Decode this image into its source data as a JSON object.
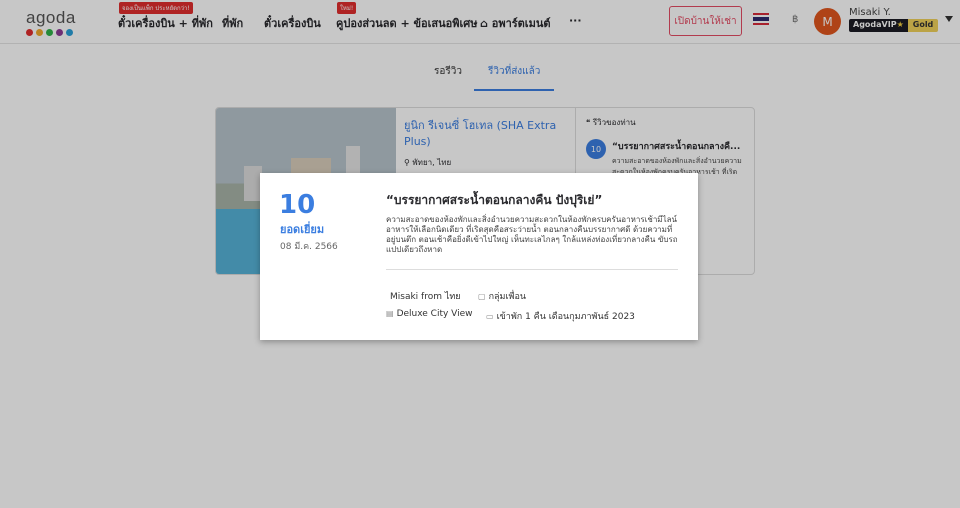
{
  "header": {
    "logo": "agoda",
    "logo_dots": [
      "#e12d2d",
      "#f0a92b",
      "#30b14a",
      "#8e3c97",
      "#2a9fd8"
    ],
    "nav": [
      {
        "label": "ตั๋วเครื่องบิน + ที่พัก",
        "badge": "จองเป็นแพ็ก ประหยัดกว่า!"
      },
      {
        "label": "ที่พัก"
      },
      {
        "label": "ตั๋วเครื่องบิน"
      },
      {
        "label": "คูปองส่วนลด + ข้อเสนอพิเศษ",
        "badge": "ใหม่!"
      },
      {
        "label": "อพาร์ตเมนต์",
        "icon": "home-icon"
      },
      {
        "label": "···"
      }
    ],
    "host_button": "เปิดบ้านให้เช่า",
    "currency": "฿",
    "avatar_initial": "M",
    "user_name": "Misaki Y.",
    "vip_label": "AgodaVIP",
    "vip_tier": "Gold"
  },
  "tabs": [
    {
      "label": "รอรีวิว",
      "active": false
    },
    {
      "label": "รีวิวที่ส่งแล้ว",
      "active": true
    }
  ],
  "card": {
    "hotel_name": "ยูนิก รีเจนซี่ โฮเทล (SHA Extra Plus)",
    "location": "พัทยา, ไทย",
    "review_heading": "รีวิวของท่าน",
    "score": "10",
    "review_title": "“บรรยากาศสระน้ำตอนกลางคื...",
    "review_snippet": "ความสะอาดของห้องพักและสิ่งอำนวยความสะดวกในห้องพักครบครันอาหารเช้า ที่เริดสุดคือบรรยากาศดี ด..."
  },
  "modal": {
    "score": "10",
    "score_label": "ยอดเยี่ยม",
    "date": "08 มี.ค. 2566",
    "title": "“บรรยากาศสระน้ำตอนกลางคืน ปังปุริเย่”",
    "body": "ความสะอาดของห้องพักและสิ่งอำนวยความสะดวกในห้องพักครบครันอาหารเช้ามีไลน์อาหารให้เลือกนิดเดียว ที่เริดสุดคือสระว่ายน้ำ ตอนกลางคืนบรรยากาศดี ด้วยความที่อยู่บนตึก ตอนเช้าคือยิ่งดีเข้าไปใหญ่ เห็นทะเลไกลๆ ใกล้แหล่งท่องเที่ยวกลางคืน ขับรถแปปเดียวถึงหาด",
    "reviewer": "Misaki from ไทย",
    "traveler_type": "กลุ่มเพื่อน",
    "room_type": "Deluxe City View",
    "stay": "เข้าพัก 1 คืน เดือนกุมภาพันธ์ 2023"
  },
  "colors": {
    "accent": "#3b7ee0",
    "host": "#e54c64"
  }
}
